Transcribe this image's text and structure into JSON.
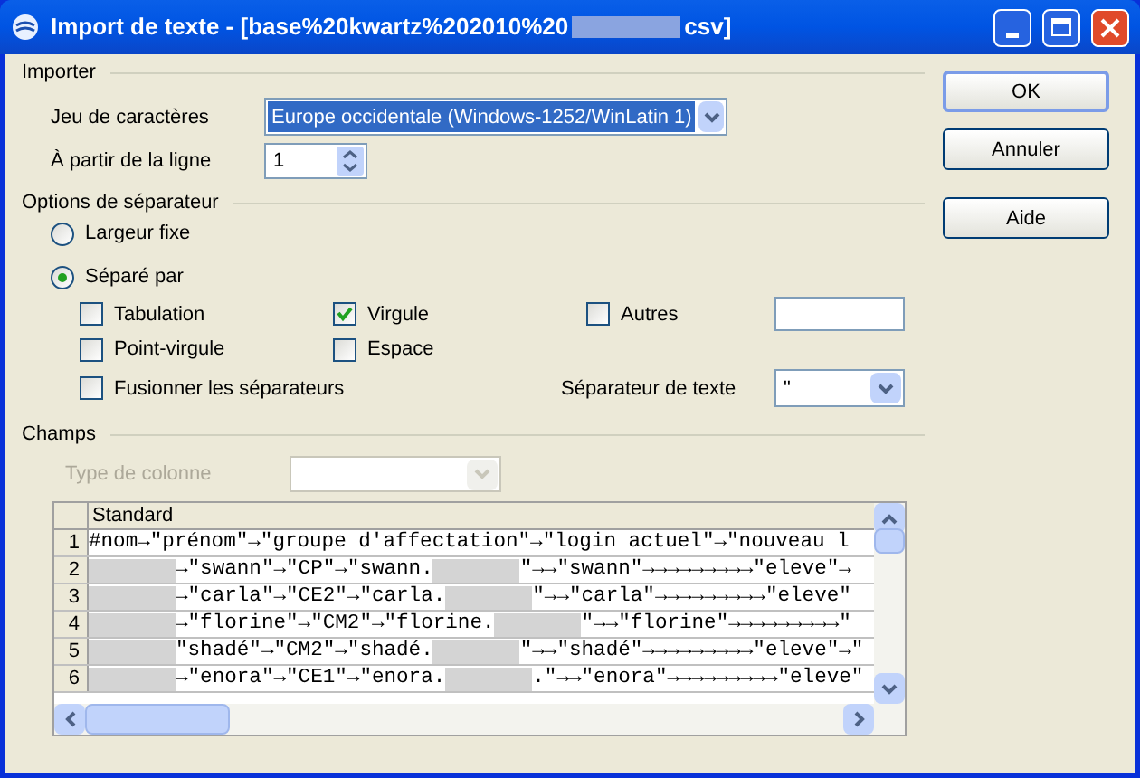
{
  "window": {
    "title_start": "Import de texte - [base%20kwartz%202010%20",
    "title_end": "csv]"
  },
  "importer": {
    "heading": "Importer",
    "charset_label": "Jeu de caractères",
    "charset_value": "Europe occidentale (Windows-1252/WinLatin 1)",
    "from_line_label": "À partir de la ligne",
    "from_line_value": "1"
  },
  "separator_options": {
    "heading": "Options de séparateur",
    "modes": [
      {
        "label": "Largeur fixe",
        "selected": false
      },
      {
        "label": "Séparé par",
        "selected": true
      }
    ],
    "checkboxes": [
      {
        "label": "Tabulation",
        "checked": false
      },
      {
        "label": "Virgule",
        "checked": true
      },
      {
        "label": "Autres",
        "checked": false
      },
      {
        "label": "Point-virgule",
        "checked": false
      },
      {
        "label": "Espace",
        "checked": false
      }
    ],
    "merge": {
      "label": "Fusionner les séparateurs",
      "checked": false
    },
    "text_separator_label": "Séparateur de texte",
    "text_separator_value": "\""
  },
  "fields": {
    "heading": "Champs",
    "column_type_label": "Type de colonne",
    "column_type_disabled": true,
    "column_header": "Standard",
    "rows": [
      {
        "number": "1",
        "segments": [
          {
            "kind": "text",
            "text": "#nom→\"prénom\"→\"groupe d'affectation\"→\"login actuel\"→\"nouveau l"
          }
        ]
      },
      {
        "number": "2",
        "segments": [
          {
            "kind": "blur"
          },
          {
            "kind": "text",
            "text": "→\"swann\"→\"CP\"→\"swann."
          },
          {
            "kind": "blur"
          },
          {
            "kind": "text",
            "text": "\"→→\"swann\"→→→→→→→→→\"eleve\"→"
          }
        ]
      },
      {
        "number": "3",
        "segments": [
          {
            "kind": "blur"
          },
          {
            "kind": "text",
            "text": "→\"carla\"→\"CE2\"→\"carla."
          },
          {
            "kind": "blur"
          },
          {
            "kind": "text",
            "text": "\"→→\"carla\"→→→→→→→→→\"eleve\""
          }
        ]
      },
      {
        "number": "4",
        "segments": [
          {
            "kind": "blur"
          },
          {
            "kind": "text",
            "text": "→\"florine\"→\"CM2\"→\"florine."
          },
          {
            "kind": "blur"
          },
          {
            "kind": "text",
            "text": "\"→→\"florine\"→→→→→→→→→\""
          }
        ]
      },
      {
        "number": "5",
        "segments": [
          {
            "kind": "blur"
          },
          {
            "kind": "text",
            "text": "\"shadé\"→\"CM2\"→\"shadé."
          },
          {
            "kind": "blur"
          },
          {
            "kind": "text",
            "text": "\"→→\"shadé\"→→→→→→→→→\"eleve\"→\""
          }
        ]
      },
      {
        "number": "6",
        "segments": [
          {
            "kind": "blur"
          },
          {
            "kind": "text",
            "text": "→\"enora\"→\"CE1\"→\"enora."
          },
          {
            "kind": "blur"
          },
          {
            "kind": "text",
            "text": ".\"→→\"enora\"→→→→→→→→→\"eleve\""
          }
        ]
      }
    ]
  },
  "buttons": [
    {
      "label": "OK",
      "default": true
    },
    {
      "label": "Annuler",
      "default": false
    },
    {
      "label": "Aide",
      "default": false
    }
  ]
}
